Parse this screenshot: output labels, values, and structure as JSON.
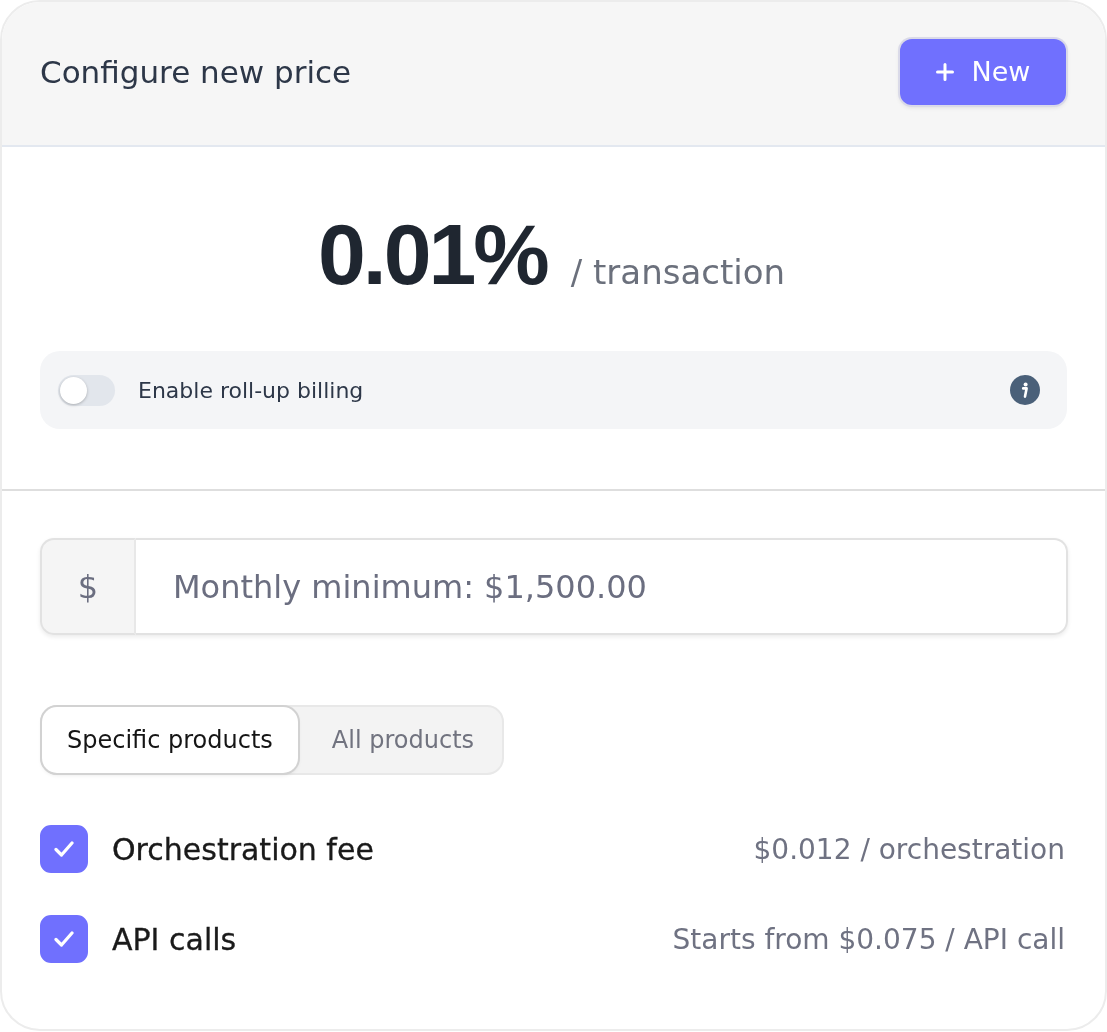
{
  "header": {
    "title": "Configure new price",
    "new_button": {
      "label": "New"
    }
  },
  "price": {
    "value": "0.01%",
    "unit": "/ transaction"
  },
  "rollup": {
    "label": "Enable roll-up billing",
    "on": false
  },
  "minimum": {
    "prefix": "$",
    "placeholder": "Monthly minimum: $1,500.00"
  },
  "scope_tabs": [
    {
      "label": "Specific products",
      "selected": true
    },
    {
      "label": "All products",
      "selected": false
    }
  ],
  "products": [
    {
      "name": "Orchestration fee",
      "checked": true,
      "price": "$0.012 / orchestration"
    },
    {
      "name": "API calls",
      "checked": true,
      "price": "Starts from $0.075 / API call"
    }
  ]
}
